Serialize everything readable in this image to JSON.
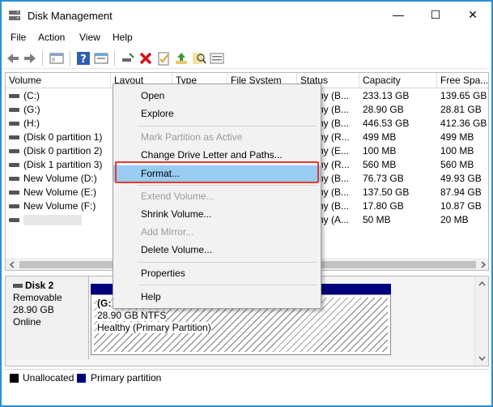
{
  "window": {
    "title": "Disk Management",
    "minimize": "—",
    "maximize": "☐",
    "close": "✕"
  },
  "menu": [
    "File",
    "Action",
    "View",
    "Help"
  ],
  "columns": [
    "Volume",
    "Layout",
    "Type",
    "File System",
    "Status",
    "Capacity",
    "Free Spa..."
  ],
  "volumes": [
    {
      "name": "(C:)",
      "status": "hy (B...",
      "capacity": "233.13 GB",
      "free": "139.65 GB"
    },
    {
      "name": "(G:)",
      "status": "hy (B...",
      "capacity": "28.90 GB",
      "free": "28.81 GB"
    },
    {
      "name": "(H:)",
      "status": "hy (B...",
      "capacity": "446.53 GB",
      "free": "412.36 GB"
    },
    {
      "name": "(Disk 0 partition 1)",
      "status": "hy (R...",
      "capacity": "499 MB",
      "free": "499 MB"
    },
    {
      "name": "(Disk 0 partition 2)",
      "status": "hy (E...",
      "capacity": "100 MB",
      "free": "100 MB"
    },
    {
      "name": "(Disk 1 partition 3)",
      "status": "hy (R...",
      "capacity": "560 MB",
      "free": "560 MB"
    },
    {
      "name": "New Volume (D:)",
      "status": "hy (B...",
      "capacity": "76.73 GB",
      "free": "49.93 GB"
    },
    {
      "name": "New Volume (E:)",
      "status": "hy (B...",
      "capacity": "137.50 GB",
      "free": "87.94 GB"
    },
    {
      "name": "New Volume (F:)",
      "status": "hy (B...",
      "capacity": "17.80 GB",
      "free": "10.87 GB"
    },
    {
      "name": "",
      "status": "hy (A...",
      "capacity": "50 MB",
      "free": "20 MB"
    }
  ],
  "context_menu": {
    "open": "Open",
    "explore": "Explore",
    "mark_active": "Mark Partition as Active",
    "change_letter": "Change Drive Letter and Paths...",
    "format": "Format...",
    "extend": "Extend Volume...",
    "shrink": "Shrink Volume...",
    "add_mirror": "Add Mirror...",
    "delete": "Delete Volume...",
    "properties": "Properties",
    "help": "Help"
  },
  "disk": {
    "name": "Disk 2",
    "kind": "Removable",
    "size": "28.90 GB",
    "state": "Online",
    "partition_label": "(G:",
    "partition_size": "28.90 GB NTFS",
    "partition_status": "Healthy (Primary Partition)"
  },
  "legend": {
    "unallocated": "Unallocated",
    "primary": "Primary partition",
    "unallocated_color": "#000000",
    "primary_color": "#00007f"
  },
  "colors": {
    "window_border": "#2a8fd8",
    "highlight": "#99ccf3",
    "callout": "#e8392f"
  }
}
